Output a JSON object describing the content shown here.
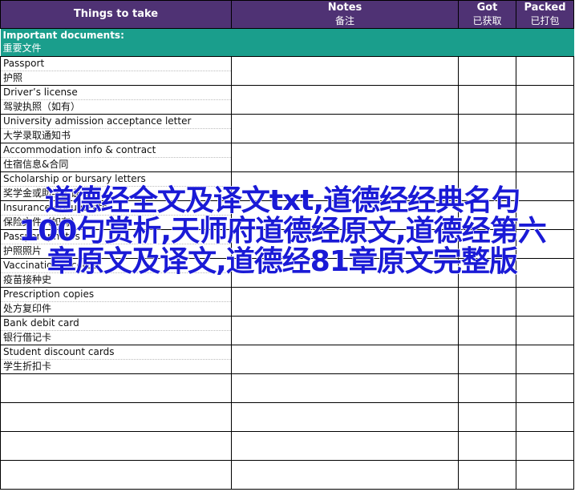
{
  "header": {
    "things": "Things to take",
    "notes_en": "Notes",
    "notes_zh": "备注",
    "got_en": "Got",
    "got_zh": "已获取",
    "packed_en": "Packed",
    "packed_zh": "已打包"
  },
  "section": {
    "title_en": "Important documents:",
    "title_zh": "重要文件"
  },
  "items": [
    {
      "en": "Passport",
      "zh": "护照"
    },
    {
      "en": "Driver’s license",
      "zh": "驾驶执照（如有）"
    },
    {
      "en": "University admission acceptance letter",
      "zh": "大学录取通知书"
    },
    {
      "en": "Accommodation info & contract",
      "zh": "住宿信息&合同"
    },
    {
      "en": "Scholarship or bursary letters",
      "zh": "奖学金或助学金证书"
    },
    {
      "en": "Insurance documents",
      "zh": "保险文件（如有）"
    },
    {
      "en": "Passport photos",
      "zh": "护照照片"
    },
    {
      "en": "Vaccination records",
      "zh": "疫苗接种史"
    },
    {
      "en": "Prescription copies",
      "zh": "处方复印件"
    },
    {
      "en": "Bank debit card",
      "zh": "银行借记卡"
    },
    {
      "en": "Student discount cards",
      "zh": "学生折扣卡"
    }
  ],
  "watermark": "道德经全文及译文txt,道德经经典名句100句赏析,天师府道德经原文,道德经第六章原文及译文,道德经81章原文完整版",
  "colors": {
    "header_bg": "#4f3274",
    "section_bg": "#1a9e8c",
    "watermark": "#1a1ad6"
  }
}
